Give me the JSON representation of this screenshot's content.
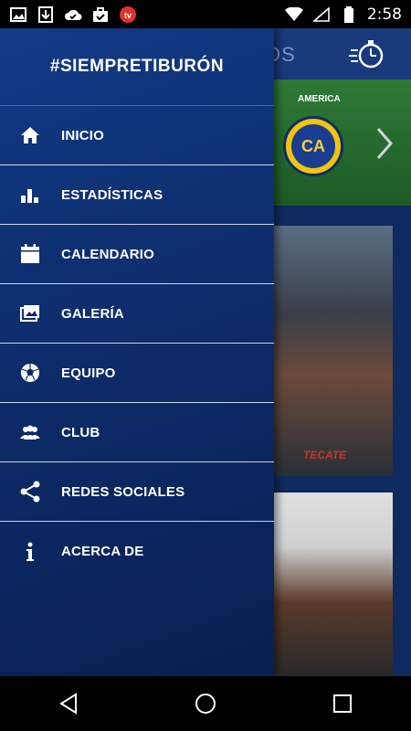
{
  "status_bar": {
    "time": "2:58",
    "left_icons": [
      "image-icon",
      "download-icon",
      "cloud-check-icon",
      "briefcase-check-icon",
      "tv-app-icon"
    ],
    "right_icons": [
      "wifi-icon",
      "signal-icon",
      "battery-icon"
    ]
  },
  "drawer": {
    "title": "#SIEMPRETIBURÓN",
    "items": [
      {
        "label": "INICIO",
        "icon": "home-icon"
      },
      {
        "label": "ESTADÍSTICAS",
        "icon": "stats-icon"
      },
      {
        "label": "CALENDARIO",
        "icon": "calendar-icon"
      },
      {
        "label": "GALERÍA",
        "icon": "gallery-icon"
      },
      {
        "label": "EQUIPO",
        "icon": "soccer-ball-icon"
      },
      {
        "label": "CLUB",
        "icon": "group-icon"
      },
      {
        "label": "REDES SOCIALES",
        "icon": "share-icon"
      },
      {
        "label": "ACERCA DE",
        "icon": "info-icon"
      }
    ]
  },
  "background": {
    "toolbar_title_fragment": "OS",
    "match": {
      "team_name": "AMERICA",
      "crest_text": "CA"
    },
    "card_logo": "TECATE"
  },
  "colors": {
    "drawer_top": "#123a86",
    "drawer_bottom": "#082052",
    "text": "#ffffff"
  },
  "nav_bar": {
    "icons": [
      "back-icon",
      "home-circle-icon",
      "recents-icon"
    ]
  }
}
